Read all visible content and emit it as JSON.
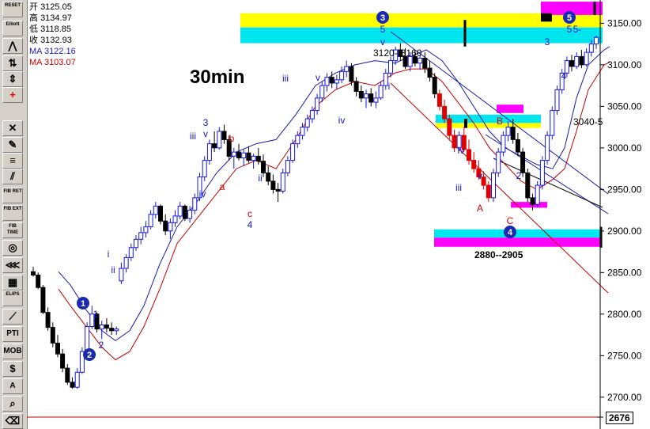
{
  "toolbar": {
    "buttons": [
      {
        "label": "RESET",
        "icon": "reset-icon"
      },
      {
        "label": "Elliott",
        "icon": "elliott-icon"
      },
      {
        "label": "",
        "icon": "wave-icon"
      },
      {
        "label": "",
        "icon": "arrows-icon"
      },
      {
        "label": "",
        "icon": "scale-icon"
      },
      {
        "label": "",
        "icon": "crosshair-icon"
      },
      {
        "label": "",
        "icon": "close-icon"
      },
      {
        "label": "",
        "icon": "pencil-icon"
      },
      {
        "label": "",
        "icon": "parallel-lines-icon"
      },
      {
        "label": "",
        "icon": "channel-icon"
      },
      {
        "label": "FIB RET",
        "icon": "fib-ret-icon"
      },
      {
        "label": "FIB EXT",
        "icon": "fib-ext-icon"
      },
      {
        "label": "FIB TIME",
        "icon": "fib-time-icon"
      },
      {
        "label": "",
        "icon": "fib-circle-icon"
      },
      {
        "label": "",
        "icon": "fan-icon"
      },
      {
        "label": "",
        "icon": "grid-icon"
      },
      {
        "label": "ELIPS",
        "icon": "ellipse-icon"
      },
      {
        "label": "",
        "icon": "diagonal-icon"
      },
      {
        "label": "PTI",
        "icon": "pti-icon"
      },
      {
        "label": "MOB",
        "icon": "mob-icon"
      },
      {
        "label": "",
        "icon": "dollar-icon"
      },
      {
        "label": "A",
        "icon": "text-icon"
      },
      {
        "label": "",
        "icon": "zoom-icon"
      },
      {
        "label": "",
        "icon": "eraser-icon"
      }
    ]
  },
  "info": {
    "open_label": "开",
    "open": "3125.05",
    "high_label": "高",
    "high": "3134.97",
    "low_label": "低",
    "low": "3118.85",
    "close_label": "收",
    "close": "3132.93",
    "ma1": "MA 3122.16",
    "ma2": "MA 3103.07"
  },
  "colors": {
    "up": "#1616e0",
    "down": "#000000",
    "down_strong": "#e00000",
    "ma_fast": "#1a1aa8",
    "ma_slow": "#c00000",
    "yellow": "#ffff00",
    "cyan": "#00e5ee",
    "magenta": "#ff00ff",
    "label_blue": "#1414c8",
    "label_red": "#d40000"
  },
  "chart_data": {
    "type": "candlestick",
    "title": "30min",
    "y_axis_ticks": [
      3150,
      3100,
      3050,
      3000,
      2950,
      2900,
      2850,
      2800,
      2750,
      2700
    ],
    "ylim": [
      2676,
      3178
    ],
    "last_price_label": "2676",
    "zones": [
      {
        "label": "",
        "y_low": 3145,
        "y_high": 3162,
        "color": "yellow"
      },
      {
        "label": "",
        "y_low": 3126,
        "y_high": 3145,
        "color": "cyan"
      },
      {
        "label": "",
        "y_low": 3160,
        "y_high": 3176,
        "color": "magenta"
      },
      {
        "label": "",
        "y_low": 3030,
        "y_high": 3040,
        "color": "cyan"
      },
      {
        "label": "",
        "y_low": 3024,
        "y_high": 3030,
        "color": "yellow"
      },
      {
        "label": "",
        "y_low": 3042,
        "y_high": 3052,
        "color": "magenta"
      },
      {
        "label": "",
        "y_low": 2928,
        "y_high": 2935,
        "color": "magenta"
      },
      {
        "label": "2880--2905",
        "y_low": 2892,
        "y_high": 2902,
        "color": "cyan"
      },
      {
        "label": "",
        "y_low": 2881,
        "y_high": 2892,
        "color": "magenta"
      }
    ],
    "text_labels": {
      "range_3120": "3120--3160",
      "target_3040": "3040-5",
      "range_2880": "2880--2905"
    },
    "wave_labels": [
      {
        "text": "1",
        "circled": true,
        "color": "blue",
        "x": 105,
        "y": 383
      },
      {
        "text": "2",
        "circled": true,
        "color": "blue",
        "x": 113,
        "y": 448
      },
      {
        "text": "3",
        "circled": true,
        "color": "blue",
        "x": 484,
        "y": 22
      },
      {
        "text": "4",
        "circled": true,
        "color": "blue",
        "x": 645,
        "y": 293
      },
      {
        "text": "5",
        "circled": true,
        "color": "blue",
        "x": 720,
        "y": 22
      },
      {
        "text": "1",
        "circled": false,
        "color": "blue",
        "x": 121,
        "y": 397
      },
      {
        "text": "2",
        "circled": false,
        "color": "blue",
        "x": 128,
        "y": 436
      },
      {
        "text": "i",
        "circled": false,
        "color": "blue",
        "x": 137,
        "y": 321
      },
      {
        "text": "ii",
        "circled": false,
        "color": "blue",
        "x": 143,
        "y": 341
      },
      {
        "text": "iii",
        "circled": false,
        "color": "blue",
        "x": 244,
        "y": 172
      },
      {
        "text": "iv",
        "circled": false,
        "color": "blue",
        "x": 256,
        "y": 245
      },
      {
        "text": "3",
        "circled": false,
        "color": "blue",
        "x": 260,
        "y": 155
      },
      {
        "text": "v",
        "circled": false,
        "color": "blue",
        "x": 260,
        "y": 169
      },
      {
        "text": "a",
        "circled": false,
        "color": "red",
        "x": 281,
        "y": 236
      },
      {
        "text": "b",
        "circled": false,
        "color": "red",
        "x": 293,
        "y": 175
      },
      {
        "text": "ii",
        "circled": false,
        "color": "blue",
        "x": 329,
        "y": 225
      },
      {
        "text": "c",
        "circled": false,
        "color": "red",
        "x": 316,
        "y": 270
      },
      {
        "text": "4",
        "circled": false,
        "color": "blue",
        "x": 316,
        "y": 284
      },
      {
        "text": "iii",
        "circled": false,
        "color": "blue",
        "x": 361,
        "y": 99
      },
      {
        "text": "v",
        "circled": false,
        "color": "blue",
        "x": 402,
        "y": 98
      },
      {
        "text": "iv",
        "circled": false,
        "color": "blue",
        "x": 432,
        "y": 152
      },
      {
        "text": "5",
        "circled": false,
        "color": "blue",
        "x": 484,
        "y": 37
      },
      {
        "text": "v",
        "circled": false,
        "color": "blue",
        "x": 484,
        "y": 53
      },
      {
        "text": "i",
        "circled": false,
        "color": "blue",
        "x": 492,
        "y": 109
      },
      {
        "text": "iv",
        "circled": false,
        "color": "blue",
        "x": 583,
        "y": 190
      },
      {
        "text": "iii",
        "circled": false,
        "color": "blue",
        "x": 580,
        "y": 237
      },
      {
        "text": "v",
        "circled": false,
        "color": "blue",
        "x": 607,
        "y": 222
      },
      {
        "text": "A",
        "circled": false,
        "color": "red",
        "x": 607,
        "y": 263
      },
      {
        "text": "B",
        "circled": false,
        "color": "red",
        "x": 632,
        "y": 153
      },
      {
        "text": "2",
        "circled": false,
        "color": "blue",
        "x": 656,
        "y": 222
      },
      {
        "text": "C",
        "circled": false,
        "color": "red",
        "x": 645,
        "y": 279
      },
      {
        "text": "3",
        "circled": false,
        "color": "blue",
        "x": 692,
        "y": 53
      },
      {
        "text": "4",
        "circled": false,
        "color": "blue",
        "x": 713,
        "y": 96
      },
      {
        "text": "5",
        "circled": false,
        "color": "blue",
        "x": 720,
        "y": 37
      },
      {
        "text": "5-",
        "circled": false,
        "color": "blue",
        "x": 730,
        "y": 37
      }
    ],
    "ohlc": [
      [
        2851,
        2857,
        2845,
        2847
      ],
      [
        2847,
        2850,
        2830,
        2832
      ],
      [
        2832,
        2835,
        2800,
        2802
      ],
      [
        2802,
        2808,
        2780,
        2784
      ],
      [
        2784,
        2790,
        2760,
        2765
      ],
      [
        2765,
        2775,
        2748,
        2752
      ],
      [
        2752,
        2758,
        2730,
        2735
      ],
      [
        2735,
        2740,
        2715,
        2718
      ],
      [
        2718,
        2724,
        2710,
        2712
      ],
      [
        2712,
        2735,
        2710,
        2730
      ],
      [
        2730,
        2760,
        2728,
        2755
      ],
      [
        2755,
        2790,
        2752,
        2785
      ],
      [
        2785,
        2810,
        2782,
        2800
      ],
      [
        2800,
        2802,
        2778,
        2782
      ],
      [
        2782,
        2792,
        2770,
        2787
      ],
      [
        2787,
        2795,
        2778,
        2783
      ],
      [
        2783,
        2790,
        2775,
        2780
      ],
      [
        2780,
        2785,
        2775,
        2782
      ],
      [
        2840,
        2862,
        2836,
        2855
      ],
      [
        2855,
        2872,
        2850,
        2868
      ],
      [
        2868,
        2885,
        2864,
        2880
      ],
      [
        2880,
        2895,
        2876,
        2890
      ],
      [
        2890,
        2905,
        2884,
        2898
      ],
      [
        2898,
        2912,
        2892,
        2905
      ],
      [
        2905,
        2925,
        2902,
        2920
      ],
      [
        2920,
        2935,
        2915,
        2930
      ],
      [
        2930,
        2932,
        2908,
        2912
      ],
      [
        2912,
        2920,
        2895,
        2900
      ],
      [
        2900,
        2915,
        2890,
        2910
      ],
      [
        2910,
        2925,
        2905,
        2918
      ],
      [
        2918,
        2935,
        2914,
        2930
      ],
      [
        2930,
        2932,
        2912,
        2915
      ],
      [
        2915,
        2930,
        2910,
        2925
      ],
      [
        2925,
        2945,
        2920,
        2940
      ],
      [
        2940,
        2970,
        2936,
        2965
      ],
      [
        2965,
        2990,
        2960,
        2985
      ],
      [
        2985,
        3010,
        2980,
        3005
      ],
      [
        3005,
        3020,
        2995,
        3000
      ],
      [
        3000,
        3025,
        2998,
        3020
      ],
      [
        3020,
        3028,
        3005,
        3010
      ],
      [
        3010,
        3015,
        2985,
        2990
      ],
      [
        2990,
        3000,
        2975,
        2995
      ],
      [
        2995,
        3005,
        2985,
        2988
      ],
      [
        2988,
        2998,
        2978,
        2994
      ],
      [
        2994,
        3002,
        2982,
        2985
      ],
      [
        2985,
        2993,
        2975,
        2990
      ],
      [
        2990,
        3000,
        2980,
        2984
      ],
      [
        2984,
        2992,
        2965,
        2970
      ],
      [
        2970,
        2978,
        2955,
        2960
      ],
      [
        2960,
        2968,
        2945,
        2950
      ],
      [
        2950,
        2958,
        2935,
        2948
      ],
      [
        2948,
        2975,
        2945,
        2970
      ],
      [
        2970,
        2990,
        2966,
        2985
      ],
      [
        2985,
        3010,
        2982,
        3005
      ],
      [
        3005,
        3020,
        3000,
        3015
      ],
      [
        3015,
        3030,
        3010,
        3025
      ],
      [
        3025,
        3040,
        3020,
        3035
      ],
      [
        3035,
        3050,
        3030,
        3045
      ],
      [
        3045,
        3065,
        3040,
        3060
      ],
      [
        3060,
        3080,
        3055,
        3075
      ],
      [
        3075,
        3090,
        3068,
        3085
      ],
      [
        3085,
        3092,
        3072,
        3078
      ],
      [
        3078,
        3088,
        3070,
        3082
      ],
      [
        3082,
        3098,
        3078,
        3092
      ],
      [
        3092,
        3105,
        3085,
        3098
      ],
      [
        3098,
        3102,
        3075,
        3080
      ],
      [
        3080,
        3085,
        3062,
        3068
      ],
      [
        3068,
        3075,
        3055,
        3060
      ],
      [
        3060,
        3070,
        3048,
        3065
      ],
      [
        3065,
        3072,
        3050,
        3055
      ],
      [
        3055,
        3068,
        3048,
        3060
      ],
      [
        3060,
        3080,
        3058,
        3075
      ],
      [
        3075,
        3095,
        3070,
        3090
      ],
      [
        3090,
        3110,
        3085,
        3105
      ],
      [
        3105,
        3122,
        3100,
        3118
      ],
      [
        3118,
        3126,
        3105,
        3110
      ],
      [
        3110,
        3120,
        3095,
        3098
      ],
      [
        3098,
        3115,
        3092,
        3110
      ],
      [
        3110,
        3118,
        3098,
        3102
      ],
      [
        3102,
        3112,
        3094,
        3108
      ],
      [
        3108,
        3115,
        3090,
        3096
      ],
      [
        3096,
        3105,
        3080,
        3085
      ],
      [
        3085,
        3090,
        3060,
        3065
      ],
      [
        3065,
        3070,
        3045,
        3050
      ],
      [
        3050,
        3058,
        3030,
        3035
      ],
      [
        3035,
        3040,
        3010,
        3015
      ],
      [
        3015,
        3022,
        2995,
        3000
      ],
      [
        3000,
        3020,
        2996,
        3015
      ],
      [
        3015,
        3025,
        2995,
        2998
      ],
      [
        2998,
        3010,
        2980,
        2985
      ],
      [
        2985,
        2995,
        2970,
        2975
      ],
      [
        2975,
        2985,
        2962,
        2965
      ],
      [
        2965,
        2972,
        2950,
        2955
      ],
      [
        2955,
        2960,
        2935,
        2940
      ],
      [
        2940,
        2975,
        2935,
        2970
      ],
      [
        2970,
        3000,
        2965,
        2995
      ],
      [
        2995,
        3020,
        2990,
        3015
      ],
      [
        3015,
        3032,
        3008,
        3025
      ],
      [
        3025,
        3035,
        3005,
        3010
      ],
      [
        3010,
        3018,
        2990,
        2995
      ],
      [
        2995,
        3000,
        2965,
        2970
      ],
      [
        2970,
        2975,
        2935,
        2940
      ],
      [
        2940,
        2945,
        2925,
        2932
      ],
      [
        2932,
        2960,
        2928,
        2955
      ],
      [
        2955,
        2990,
        2950,
        2985
      ],
      [
        2985,
        3020,
        2980,
        3015
      ],
      [
        3015,
        3050,
        3010,
        3045
      ],
      [
        3045,
        3075,
        3040,
        3070
      ],
      [
        3070,
        3095,
        3065,
        3090
      ],
      [
        3090,
        3110,
        3085,
        3105
      ],
      [
        3105,
        3112,
        3092,
        3098
      ],
      [
        3098,
        3115,
        3095,
        3110
      ],
      [
        3110,
        3118,
        3096,
        3100
      ],
      [
        3100,
        3120,
        3098,
        3115
      ],
      [
        3115,
        3130,
        3110,
        3125
      ],
      [
        3125,
        3135,
        3119,
        3133
      ]
    ],
    "ma_fast": [
      [
        2851,
        40
      ],
      [
        2835,
        55
      ],
      [
        2805,
        75
      ],
      [
        2780,
        95
      ],
      [
        2768,
        112
      ],
      [
        2780,
        130
      ],
      [
        2810,
        148
      ],
      [
        2860,
        168
      ],
      [
        2905,
        190
      ],
      [
        2935,
        215
      ],
      [
        2970,
        240
      ],
      [
        2995,
        265
      ],
      [
        3005,
        290
      ],
      [
        3010,
        315
      ],
      [
        3040,
        340
      ],
      [
        3075,
        365
      ],
      [
        3090,
        390
      ],
      [
        3100,
        415
      ],
      [
        3105,
        440
      ],
      [
        3102,
        465
      ],
      [
        3110,
        485
      ],
      [
        3118,
        505
      ],
      [
        3105,
        525
      ],
      [
        3080,
        545
      ],
      [
        3050,
        565
      ],
      [
        3020,
        585
      ],
      [
        3000,
        605
      ],
      [
        2990,
        625
      ],
      [
        2980,
        645
      ],
      [
        2975,
        665
      ],
      [
        3000,
        680
      ],
      [
        3060,
        695
      ],
      [
        3100,
        710
      ],
      [
        3118,
        730
      ],
      [
        3122,
        737
      ]
    ],
    "ma_slow": [
      [
        2830,
        40
      ],
      [
        2810,
        55
      ],
      [
        2785,
        75
      ],
      [
        2760,
        95
      ],
      [
        2745,
        112
      ],
      [
        2755,
        130
      ],
      [
        2785,
        148
      ],
      [
        2830,
        168
      ],
      [
        2885,
        190
      ],
      [
        2915,
        215
      ],
      [
        2945,
        240
      ],
      [
        2975,
        265
      ],
      [
        2985,
        290
      ],
      [
        2975,
        315
      ],
      [
        3010,
        340
      ],
      [
        3050,
        365
      ],
      [
        3070,
        390
      ],
      [
        3080,
        415
      ],
      [
        3075,
        440
      ],
      [
        3090,
        465
      ],
      [
        3095,
        485
      ],
      [
        3095,
        505
      ],
      [
        3080,
        525
      ],
      [
        3055,
        545
      ],
      [
        3030,
        565
      ],
      [
        3000,
        585
      ],
      [
        2980,
        605
      ],
      [
        2960,
        625
      ],
      [
        2950,
        645
      ],
      [
        2962,
        665
      ],
      [
        2975,
        680
      ],
      [
        3020,
        695
      ],
      [
        3070,
        710
      ],
      [
        3100,
        730
      ],
      [
        3103,
        737
      ]
    ]
  }
}
